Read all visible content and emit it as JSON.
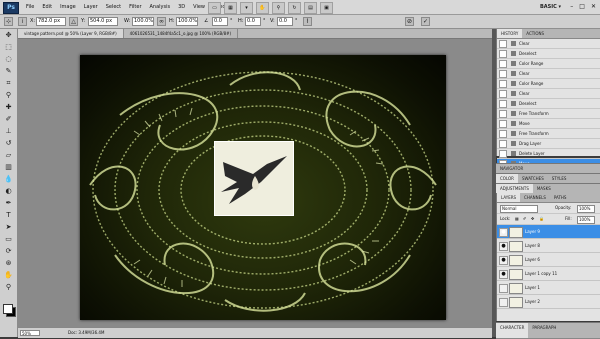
{
  "menubar": {
    "logo": "Ps",
    "menus": [
      "File",
      "Edit",
      "Image",
      "Layer",
      "Select",
      "Filter",
      "Analysis",
      "3D",
      "View",
      "Window",
      "Help"
    ],
    "workspace": "BASIC ▾"
  },
  "options": {
    "x": "782.0 px",
    "y": "504.0 px",
    "w": "100.0%",
    "h": "100.0%",
    "angle": "0.0",
    "hskew": "0.0",
    "vskew": "0.0"
  },
  "document": {
    "tabs": [
      "vintage pattern.psd @ 50% (Layer 9, RGB/8#)",
      "4061026531_1484f4a5c1_o.jpg @ 100% (RGB/8#)"
    ],
    "zoom": "50%",
    "info": "Doc: 3.49M/36.4M"
  },
  "history": {
    "tabs": [
      "HISTORY",
      "ACTIONS"
    ],
    "items": [
      "Clear",
      "Deselect",
      "Color Range",
      "Clear",
      "Color Range",
      "Clear",
      "Deselect",
      "Free Transform",
      "Move",
      "Free Transform",
      "Drag Layer",
      "Delete Layer",
      "Move"
    ],
    "selected": 12
  },
  "panels": {
    "navigator": [
      "NAVIGATOR"
    ],
    "color": [
      "COLOR",
      "SWATCHES",
      "STYLES"
    ],
    "adjust": [
      "ADJUSTMENTS",
      "MASKS"
    ],
    "layers_tabs": [
      "LAYERS",
      "CHANNELS",
      "PATHS"
    ],
    "character": [
      "CHARACTER",
      "PARAGRAPH"
    ]
  },
  "layers": {
    "blend": "Normal",
    "opacity_label": "Opacity:",
    "opacity": "100%",
    "lock_label": "Lock:",
    "fill_label": "Fill:",
    "fill": "100%",
    "items": [
      {
        "name": "Layer 9",
        "visible": true,
        "selected": true
      },
      {
        "name": "Layer 8",
        "visible": true,
        "selected": false
      },
      {
        "name": "Layer 6",
        "visible": true,
        "selected": false
      },
      {
        "name": "Layer 1 copy 11",
        "visible": true,
        "selected": false
      },
      {
        "name": "Layer 1",
        "visible": false,
        "selected": false
      },
      {
        "name": "Layer 2",
        "visible": false,
        "selected": false
      }
    ]
  },
  "colors": {
    "selection": "#3b8ee6",
    "pattern": "#c9d98a"
  }
}
